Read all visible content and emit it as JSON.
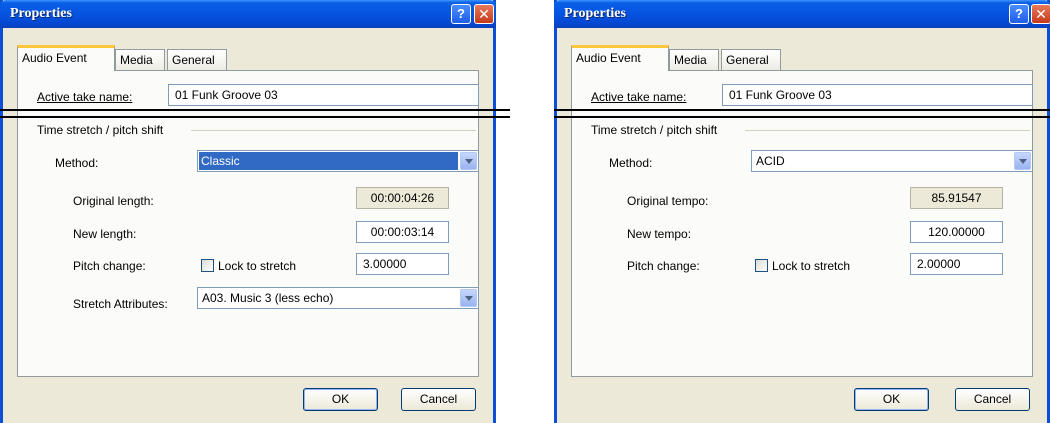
{
  "dialogs": [
    {
      "title": "Properties",
      "tabs": [
        "Audio Event",
        "Media",
        "General"
      ],
      "active_take_label": "Active take name:",
      "active_take_value": "01 Funk Groove 03",
      "group_label": "Time stretch / pitch shift",
      "method_label": "Method:",
      "method_value": "Classic",
      "original_label": "Original length:",
      "original_value": "00:00:04:26",
      "new_label": "New length:",
      "new_value": "00:00:03:14",
      "pitch_label": "Pitch change:",
      "lock_label": "Lock to stretch",
      "pitch_value": "3.00000",
      "stretch_label": "Stretch Attributes:",
      "stretch_value": "A03. Music 3 (less echo)",
      "ok_label": "OK",
      "cancel_label": "Cancel"
    },
    {
      "title": "Properties",
      "tabs": [
        "Audio Event",
        "Media",
        "General"
      ],
      "active_take_label": "Active take name:",
      "active_take_value": "01 Funk Groove 03",
      "group_label": "Time stretch / pitch shift",
      "method_label": "Method:",
      "method_value": "ACID",
      "original_label": "Original tempo:",
      "original_value": "85.91547",
      "new_label": "New tempo:",
      "new_value": "120.00000",
      "pitch_label": "Pitch change:",
      "lock_label": "Lock to stretch",
      "pitch_value": "2.00000",
      "ok_label": "OK",
      "cancel_label": "Cancel"
    }
  ],
  "icons": {
    "help": "?",
    "close": "✕"
  },
  "colors": {
    "titlebar": "#0554e0",
    "selection": "#316ac5",
    "tab_highlight": "#ffc83c"
  }
}
